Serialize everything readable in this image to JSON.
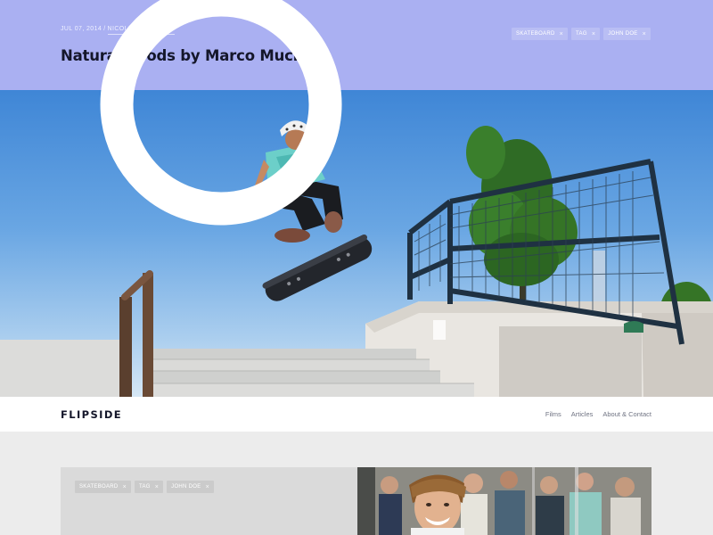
{
  "post": {
    "date": "JUL 07, 2014",
    "separator": "/",
    "author": "NICOLE ANTOGADIO",
    "title": "Natural goods by Marco Mucig"
  },
  "tags": [
    {
      "label": "SKATEBOARD",
      "remove_icon": "×"
    },
    {
      "label": "TAG",
      "remove_icon": "×"
    },
    {
      "label": "JOHN DOE",
      "remove_icon": "×"
    }
  ],
  "nav": {
    "logo": "FLIPSIDE",
    "links": [
      {
        "label": "Films"
      },
      {
        "label": "Articles"
      },
      {
        "label": "About & Contact"
      }
    ]
  },
  "card": {
    "tags": [
      {
        "label": "SKATEBOARD",
        "remove_icon": "×"
      },
      {
        "label": "TAG",
        "remove_icon": "×"
      },
      {
        "label": "JOHN DOE",
        "remove_icon": "×"
      }
    ]
  },
  "colors": {
    "header_band": "#aab0f2",
    "title": "#14162a",
    "nav_link": "#6f7382",
    "lower_bg": "#ececec",
    "card_bg": "#dadada"
  },
  "images": {
    "hero": "skateboarder-kickflip-photo",
    "card_photo": "smiling-man-crowd-photo"
  }
}
